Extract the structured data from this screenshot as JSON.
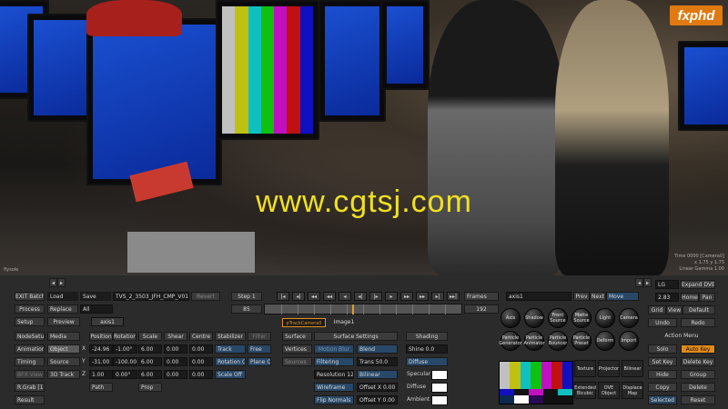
{
  "viewport": {
    "watermark": "www.cgtsj.com",
    "logo": "fxphd",
    "label_left": "flysole",
    "info_lines": [
      "Time 0000 [Camera0]",
      "x 1.75 y 1.75",
      "Linear Gamma 1.00"
    ],
    "color_bars": [
      "#c0c0c0",
      "#c0c010",
      "#10c0c0",
      "#10c010",
      "#c010c0",
      "#c01010",
      "#1010c0"
    ]
  },
  "row0": {
    "exit_batch": "EXIT Batch",
    "load": "Load",
    "save": "Save",
    "clip_name": "TVS_2_3503_JFH_CMP_V010",
    "revert": "Revert",
    "step": "Step 1",
    "frames": "Frames",
    "node": "axis1",
    "prev": "Prev",
    "next": "Next",
    "move": "Move",
    "l_field": "LG",
    "expand": "Expand DVE"
  },
  "row1": {
    "process": "Process",
    "replace": "Replace",
    "all": "All",
    "frame_start": "85",
    "frame_end": "192",
    "zoom": "2.83",
    "home": "Home",
    "pan": "Pan"
  },
  "row2": {
    "setup": "Setup",
    "preview": "Preview",
    "node_tab": "axis1",
    "grid": "Grid",
    "view": "View",
    "default": "Default",
    "undo": "Undo",
    "redo": "Redo"
  },
  "left_menu": [
    "NodeSetup",
    "Animation",
    "Timing",
    "BFX View",
    "R.Grab [1]",
    "Result"
  ],
  "left_menu2": [
    "Media",
    "Object",
    "Source",
    "3D Track"
  ],
  "axis_headers": [
    "Position",
    "Rotation",
    "Scale",
    "Shear",
    "Centre",
    "Stabilizer",
    "Filter"
  ],
  "axis_rows": [
    {
      "axis": "X",
      "values": [
        "-24.96",
        "-1.00°",
        "6.00",
        "0.00",
        "0.00"
      ],
      "extra1": "Track",
      "extra2": "Free"
    },
    {
      "axis": "Y",
      "values": [
        "-31.00",
        "-100.00°",
        "6.00",
        "0.00",
        "0.00"
      ],
      "extra1": "Rotation Off",
      "extra2": "Plane Off"
    },
    {
      "axis": "Z",
      "values": [
        "1.00",
        "0.00°",
        "6.00",
        "0.00",
        "0.00"
      ],
      "extra1": "Scale Off",
      "extra2": ""
    }
  ],
  "path": "Path",
  "prop": "Prop",
  "surface": {
    "tab1": "pTrackCamera0",
    "tab2": "Image1",
    "settings": "Surface Settings",
    "shading": "Shading",
    "surface_tab": "Surface",
    "vertices": "Vertices",
    "sources": "Sources",
    "motion_blur": "Motion Blur",
    "filtering": "Filtering",
    "resolution": "Resolution 12",
    "wireframe": "Wireframe",
    "flip_normals": "Flip Normals",
    "blend": "Blend",
    "trans": "Trans 50.0",
    "bilinear": "Bilinear",
    "offset_x": "Offset X 0.00",
    "offset_y": "Offset Y 0.00",
    "shine": "Shine 0.0",
    "specular": "Specular",
    "diffuse": "Diffuse",
    "ambient": "Ambient"
  },
  "nodes_row1": [
    "Axis",
    "Shadow",
    "Front Source",
    "Matte Source",
    "Light",
    "Camera"
  ],
  "nodes_row2": [
    "Particle Generator",
    "Particle Animator",
    "Particle Bouncer",
    "Particle Preset",
    "Deform",
    "Import"
  ],
  "nodes_sq": [
    "Texture",
    "Projector",
    "Bilinear",
    "Extended Bicubic",
    "DVE Object",
    "Displace Map"
  ],
  "action_menu": {
    "title": "Action Menu",
    "solo": "Solo",
    "auto_key": "Auto Key",
    "set_key": "Set Key",
    "delete_key": "Delete Key",
    "hide": "Hide",
    "group": "Group",
    "copy": "Copy",
    "delete": "Delete",
    "selected": "Selected",
    "reset": "Reset"
  }
}
